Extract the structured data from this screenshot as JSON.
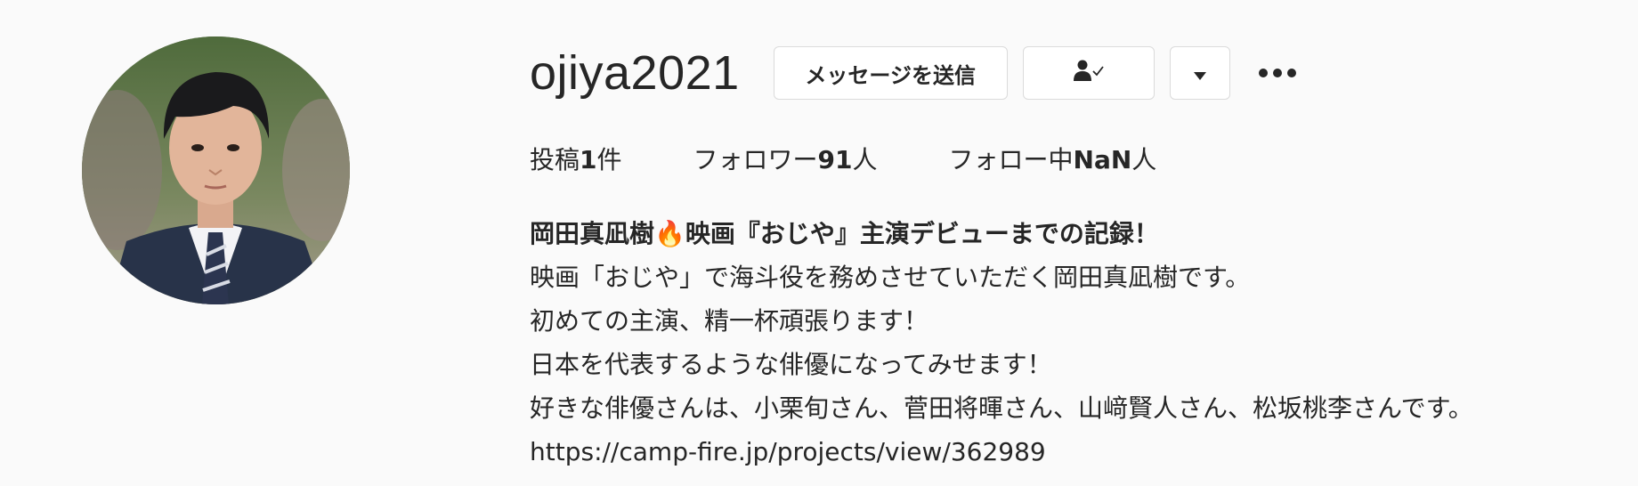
{
  "profile": {
    "username": "ojiya2021",
    "buttons": {
      "message_label": "メッセージを送信"
    },
    "icons": {
      "follow": "person-check-icon",
      "dropdown": "caret-down-icon",
      "more": "more-options-icon"
    },
    "stats": {
      "posts_label": "投稿",
      "posts_count": "1",
      "posts_unit": "件",
      "followers_label": "フォロワー",
      "followers_count": "91",
      "followers_unit": "人",
      "following_label": "フォロー中",
      "following_count": "NaN",
      "following_unit": "人"
    },
    "bio": {
      "name_line_a": "岡田真凪樹",
      "name_line_emoji": "🔥",
      "name_line_b": "映画『おじや』主演デビューまでの記録！",
      "lines": [
        "映画「おじや」で海斗役を務めさせていただく岡田真凪樹です。",
        "初めての主演、精一杯頑張ります！",
        "日本を代表するような俳優になってみせます！",
        "好きな俳優さんは、小栗旬さん、菅田将暉さん、山﨑賢人さん、松坂桃李さんです。"
      ],
      "link": "https://camp-fire.jp/projects/view/362989"
    }
  }
}
